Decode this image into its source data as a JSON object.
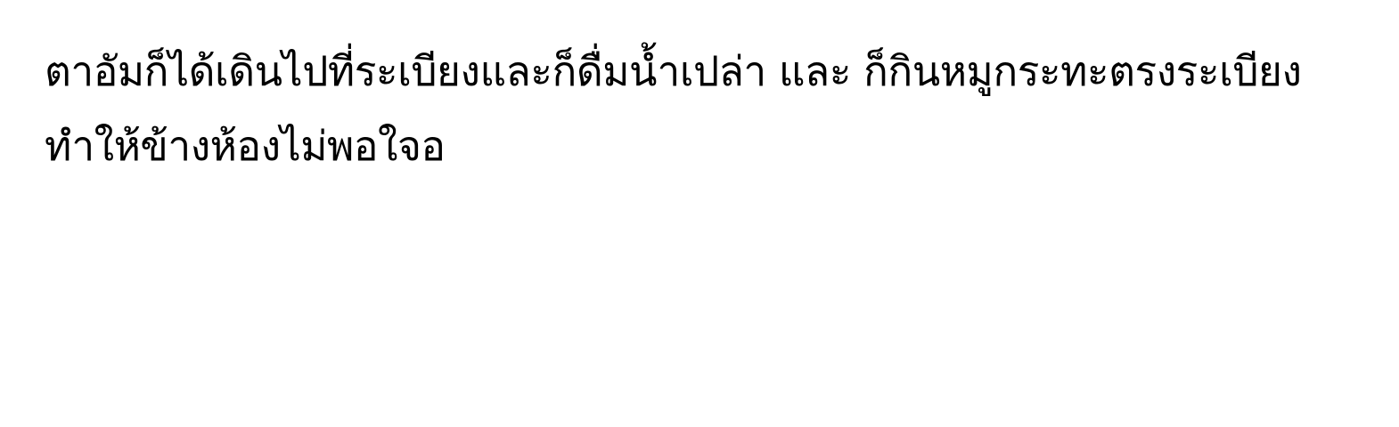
{
  "document": {
    "lines": [
      "ตาอัมก็ได้เดินไปที่ระเบียงและก็ดื่มน้ำเปล่า และ ก็กินหมูกระทะตรงระเบียง",
      "ทำให้ข้างห้องไม่พอใจอ"
    ]
  }
}
